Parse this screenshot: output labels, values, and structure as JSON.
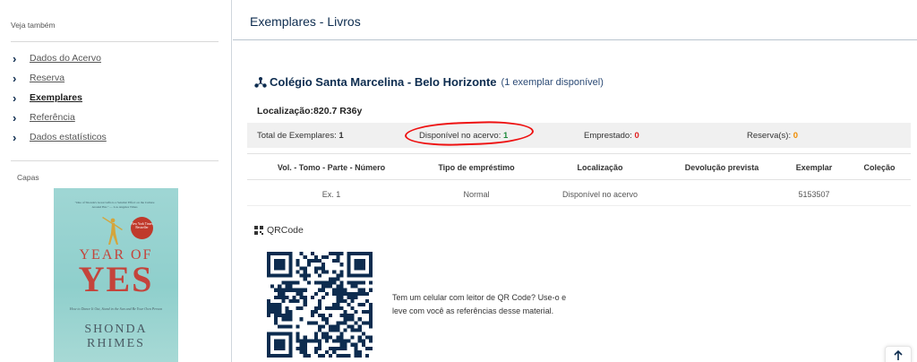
{
  "sidebar": {
    "see_also_label": "Veja também",
    "items": [
      {
        "label": "Dados do Acervo"
      },
      {
        "label": "Reserva"
      },
      {
        "label": "Exemplares",
        "active": true
      },
      {
        "label": "Referência"
      },
      {
        "label": "Dados estatísticos"
      }
    ],
    "covers_label": "Capas",
    "cover": {
      "blurb": "\"One of Shonda's Great Gifts is a Seismic Effect on the Culture Around Her.\" — Los Angeles Times",
      "badge": "New York Times Bestseller",
      "title_line1": "YEAR OF",
      "title_line2": "YES",
      "subtitle": "How to Dance It Out, Stand in the Sun and Be Your Own Person",
      "author_line1": "SHONDA",
      "author_line2": "RHIMES"
    }
  },
  "main": {
    "title": "Exemplares - Livros",
    "library": {
      "name": "Colégio Santa Marcelina - Belo Horizonte",
      "availability": "(1 exemplar disponível)"
    },
    "location": "Localização:820.7 R36y",
    "summary": {
      "total_label": "Total de Exemplares:",
      "total_value": "1",
      "available_label": "Disponível no acervo:",
      "available_value": "1",
      "loaned_label": "Emprestado:",
      "loaned_value": "0",
      "reserved_label": "Reserva(s):",
      "reserved_value": "0"
    },
    "table": {
      "headers": [
        "Vol. - Tomo - Parte - Número",
        "Tipo de empréstimo",
        "Localização",
        "Devolução prevista",
        "Exemplar",
        "Coleção"
      ],
      "rows": [
        [
          "Ex. 1",
          "Normal",
          "Disponível no acervo",
          "",
          "5153507",
          ""
        ]
      ]
    },
    "qr": {
      "label": "QRCode",
      "text": "Tem um celular com leitor de QR Code? Use-o e leve com você as referências desse material."
    }
  },
  "colors": {
    "navy": "#0d2c4f",
    "available_green": "#1e8a3c",
    "loaned_red": "#e02020",
    "reserved_orange": "#f08c00",
    "highlight_circle": "#ee1111"
  },
  "icons": {
    "sidebar_chevron": "chevron-right-icon",
    "library": "institution-icon",
    "qr": "qrcode-icon",
    "scroll_top": "arrow-up-icon"
  }
}
